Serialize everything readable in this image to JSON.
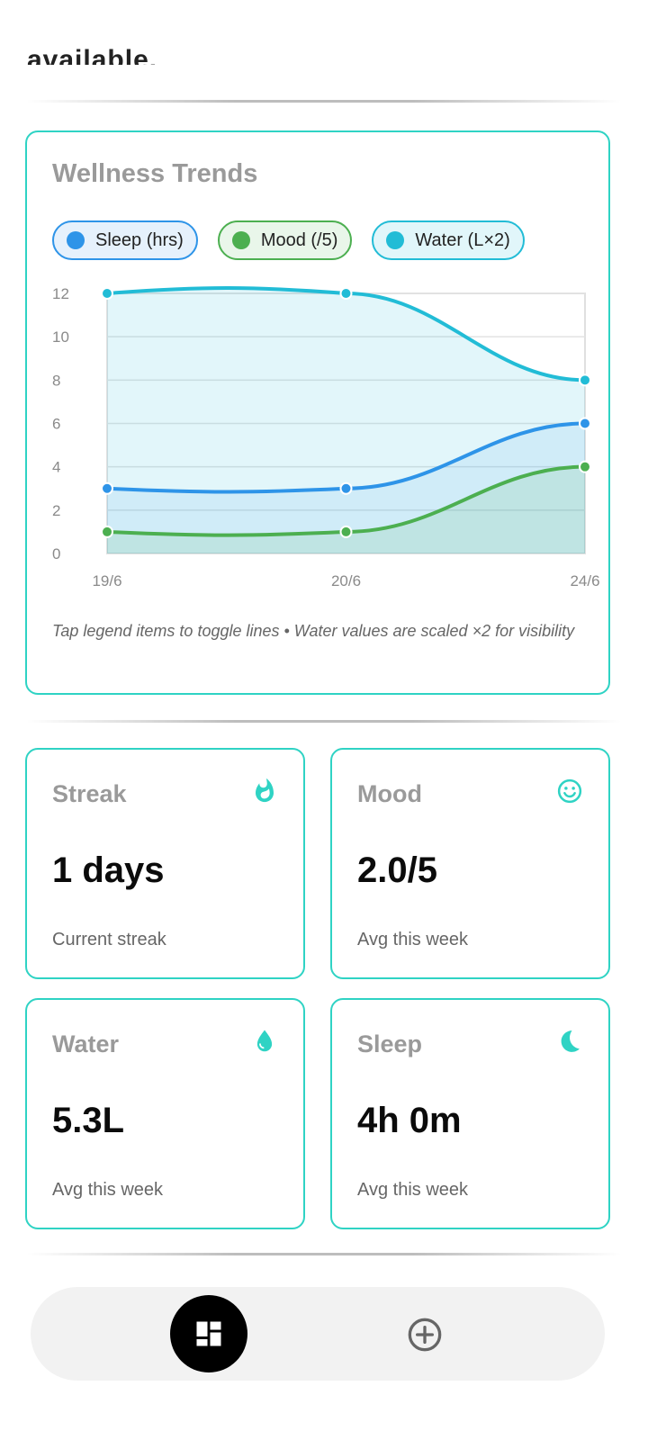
{
  "top_cut_text": "available.",
  "trends": {
    "title": "Wellness Trends",
    "note": "Tap legend items to toggle lines • Water values are scaled ×2 for visibility",
    "legend": [
      {
        "label": "Sleep (hrs)",
        "color": "#2e94e8"
      },
      {
        "label": "Mood (/5)",
        "color": "#4caf50"
      },
      {
        "label": "Water (L×2)",
        "color": "#22bcd6"
      }
    ]
  },
  "chart_data": {
    "type": "area",
    "categories": [
      "19/6",
      "20/6",
      "24/6"
    ],
    "y_ticks": [
      0,
      2,
      4,
      6,
      8,
      10,
      12
    ],
    "ylim": [
      0,
      12
    ],
    "grid": true,
    "series": [
      {
        "name": "Water (L×2)",
        "color": "#22bcd6",
        "values": [
          12,
          12,
          8
        ]
      },
      {
        "name": "Sleep (hrs)",
        "color": "#2e94e8",
        "values": [
          3,
          3,
          6
        ]
      },
      {
        "name": "Mood (/5)",
        "color": "#4caf50",
        "values": [
          1,
          1,
          4
        ]
      }
    ]
  },
  "stats": {
    "streak": {
      "title": "Streak",
      "value": "1 days",
      "sub": "Current streak",
      "icon": "fire-icon"
    },
    "mood": {
      "title": "Mood",
      "value": "2.0/5",
      "sub": "Avg this week",
      "icon": "smiley-icon"
    },
    "water": {
      "title": "Water",
      "value": "5.3L",
      "sub": "Avg this week",
      "icon": "water-drop-icon"
    },
    "sleep": {
      "title": "Sleep",
      "value": "4h 0m",
      "sub": "Avg this week",
      "icon": "moon-icon"
    }
  },
  "accent_color": "#2fd3c4",
  "nav": {
    "items": [
      "dashboard-icon",
      "add-circle-icon"
    ]
  }
}
